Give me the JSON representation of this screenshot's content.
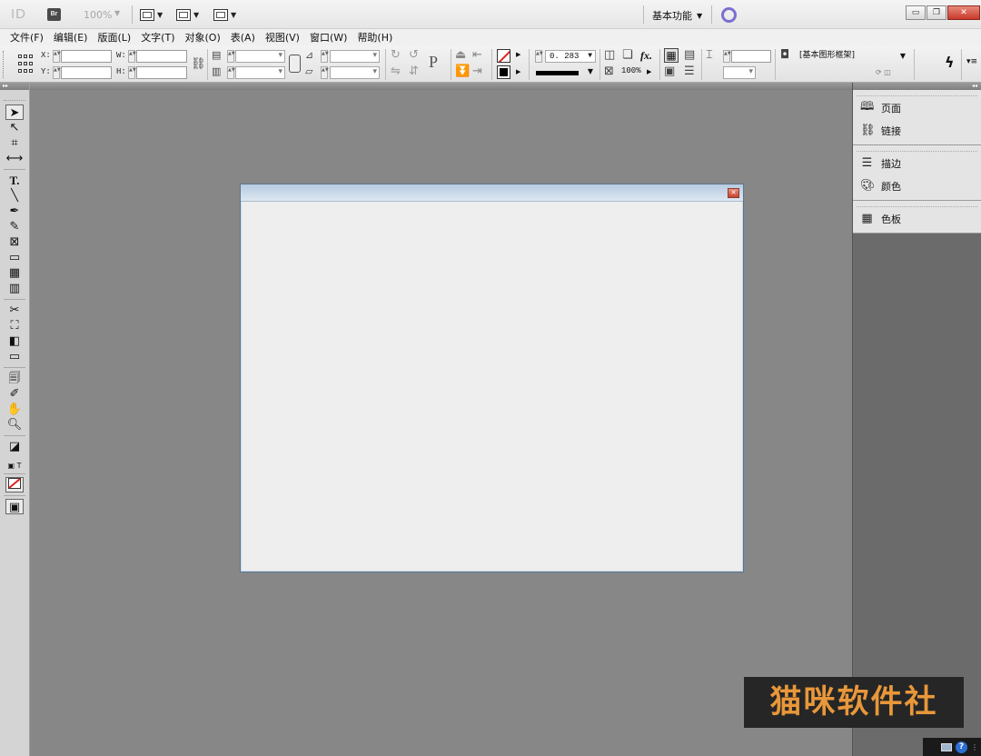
{
  "app": {
    "logo": "ID",
    "bridge": "Br",
    "zoom": "100%",
    "workspace": "基本功能"
  },
  "menu": [
    "文件(F)",
    "编辑(E)",
    "版面(L)",
    "文字(T)",
    "对象(O)",
    "表(A)",
    "视图(V)",
    "窗口(W)",
    "帮助(H)"
  ],
  "control": {
    "x_label": "X:",
    "y_label": "Y:",
    "w_label": "W:",
    "h_label": "H:",
    "stroke_weight": "0. 283",
    "opacity": "100%",
    "object_style": "[基本图形框架]",
    "text_frame_letter": "P"
  },
  "panels": {
    "group1": [
      {
        "icon": "pages-icon",
        "label": "页面"
      },
      {
        "icon": "links-icon",
        "label": "链接"
      }
    ],
    "group2": [
      {
        "icon": "stroke-icon",
        "label": "描边"
      },
      {
        "icon": "color-icon",
        "label": "颜色"
      }
    ],
    "group3": [
      {
        "icon": "swatches-icon",
        "label": "色板"
      }
    ]
  },
  "watermark": "猫咪软件社",
  "tray": {
    "help": "?"
  }
}
